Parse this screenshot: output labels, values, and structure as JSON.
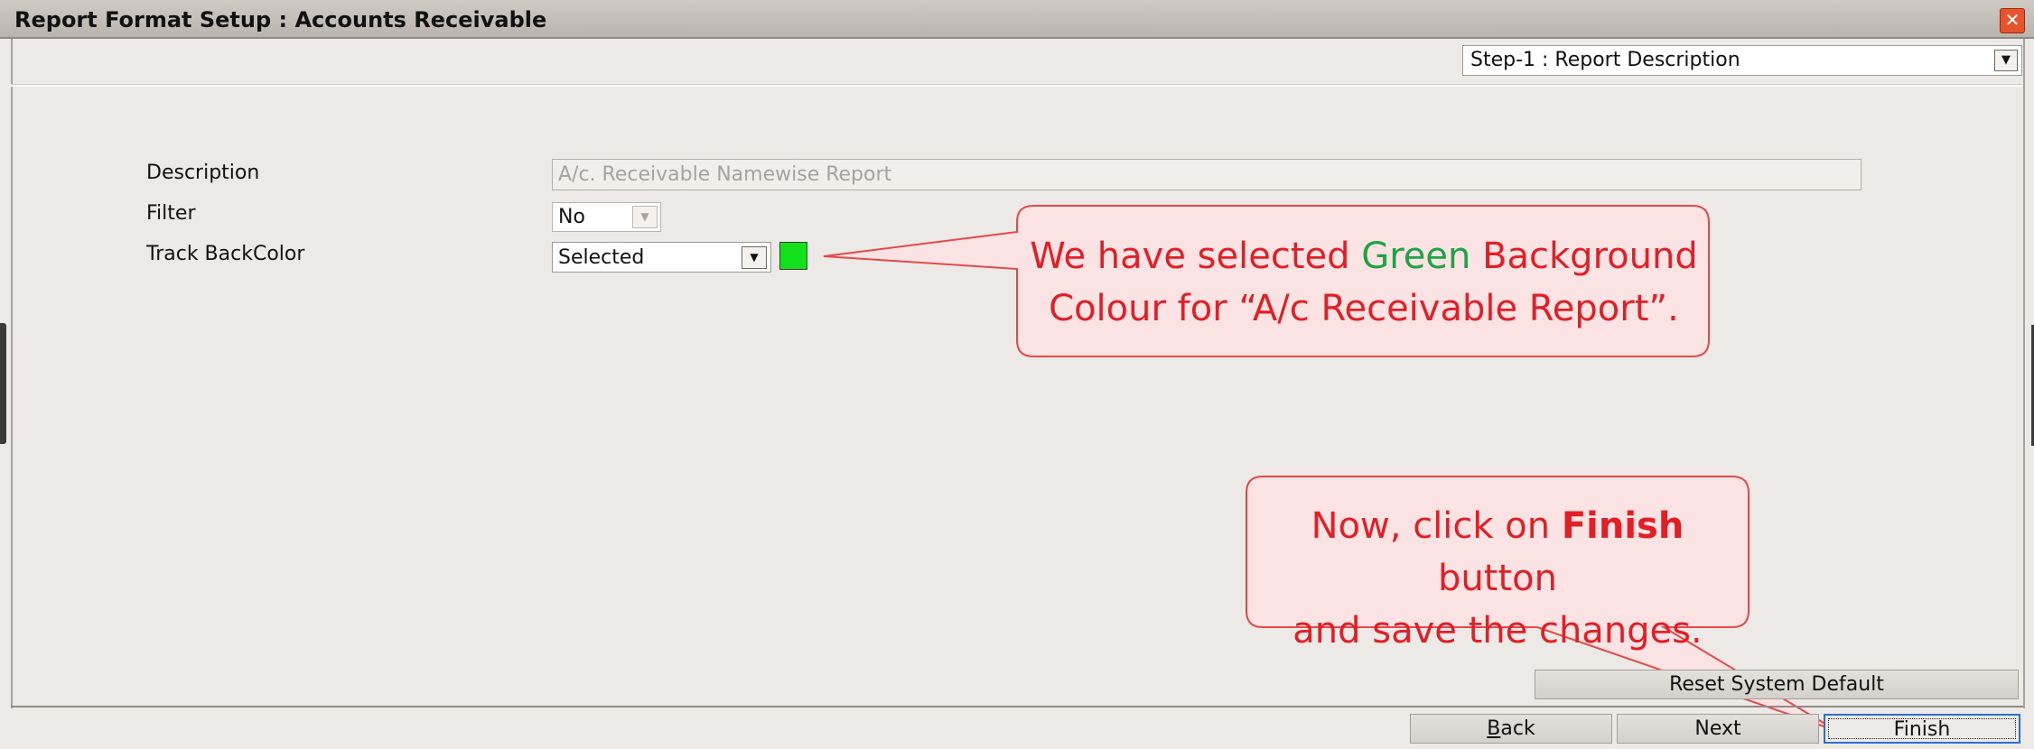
{
  "window": {
    "title": "Report Format Setup : Accounts Receivable",
    "close_glyph": "✕"
  },
  "step": {
    "selected": "Step-1 : Report Description"
  },
  "form": {
    "description": {
      "label": "Description",
      "value": "A/c. Receivable Namewise Report"
    },
    "filter": {
      "label": "Filter",
      "value": "No"
    },
    "track_backcolor": {
      "label": "Track BackColor",
      "value": "Selected",
      "swatch_color": "#11E01A"
    }
  },
  "callouts": {
    "color_note": {
      "line1_prefix": "We have selected ",
      "line1_green": "Green",
      "line1_suffix": " Background",
      "line2": "Colour for “A/c Receivable Report”."
    },
    "finish_note": {
      "line1_prefix": "Now, click on ",
      "line1_bold": "Finish",
      "line1_suffix": " button",
      "line2": "and save the changes."
    },
    "text_color": "#E01F26",
    "accent_green": "#1DA545"
  },
  "buttons": {
    "reset": "Reset System Default",
    "back_mnemonic": "B",
    "back_rest": "ack",
    "next": "Next",
    "finish": "Finish"
  },
  "colors": {
    "background": "#ECE9E6",
    "titlebar": "#C4BFB8",
    "focus_border": "#2F6FD0"
  }
}
